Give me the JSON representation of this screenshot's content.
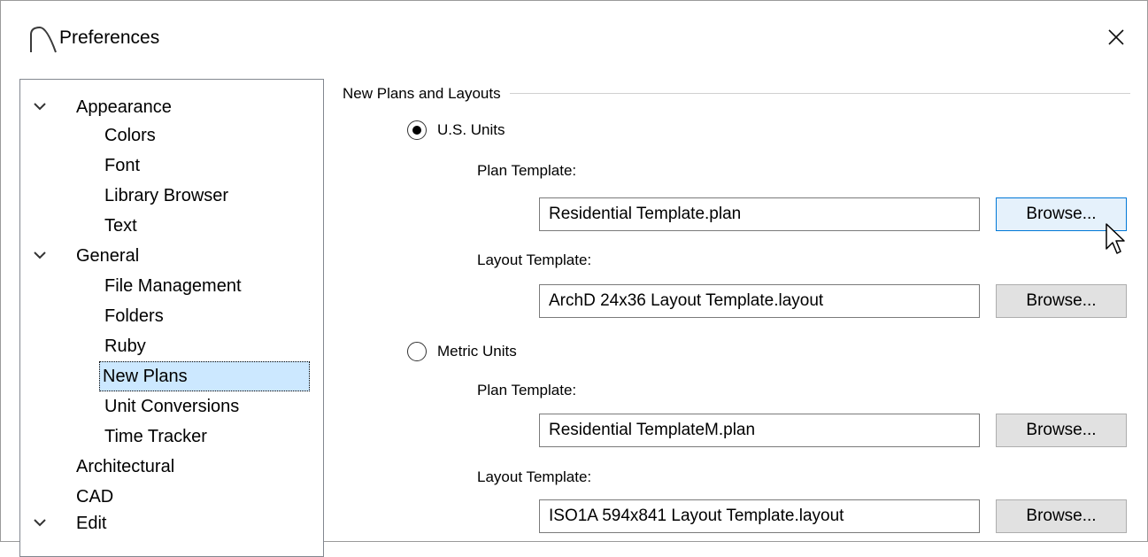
{
  "window": {
    "title": "Preferences"
  },
  "tree": {
    "items": [
      {
        "label": "Appearance",
        "level": 0,
        "expanded": true
      },
      {
        "label": "Colors",
        "level": 1
      },
      {
        "label": "Font",
        "level": 1
      },
      {
        "label": "Library Browser",
        "level": 1
      },
      {
        "label": "Text",
        "level": 1
      },
      {
        "label": "General",
        "level": 0,
        "expanded": true
      },
      {
        "label": "File Management",
        "level": 1
      },
      {
        "label": "Folders",
        "level": 1
      },
      {
        "label": "Ruby",
        "level": 1
      },
      {
        "label": "New Plans",
        "level": 1,
        "selected": true
      },
      {
        "label": "Unit Conversions",
        "level": 1
      },
      {
        "label": "Time Tracker",
        "level": 1
      },
      {
        "label": "Architectural",
        "level": 0
      },
      {
        "label": "CAD",
        "level": 0
      },
      {
        "label": "Edit",
        "level": 0,
        "expanded": true
      }
    ]
  },
  "panel": {
    "group_label": "New Plans and Layouts",
    "us_units": {
      "label": "U.S. Units",
      "selected": true,
      "plan_template_label": "Plan Template:",
      "plan_template_value": "Residential Template.plan",
      "layout_template_label": "Layout Template:",
      "layout_template_value": "ArchD 24x36 Layout Template.layout"
    },
    "metric_units": {
      "label": "Metric Units",
      "selected": false,
      "plan_template_label": "Plan Template:",
      "plan_template_value": "Residential TemplateM.plan",
      "layout_template_label": "Layout Template:",
      "layout_template_value": "ISO1A 594x841 Layout Template.layout"
    },
    "browse_label": "Browse..."
  },
  "colors": {
    "selection_bg": "#cce8ff",
    "button_bg": "#e1e1e1",
    "button_hover_bg": "#e5f1fb",
    "button_hover_border": "#0078d7"
  },
  "icons": {
    "app": "arch-icon",
    "close": "close-icon",
    "expand": "chevron-down-icon",
    "pointer": "mouse-pointer-icon"
  }
}
